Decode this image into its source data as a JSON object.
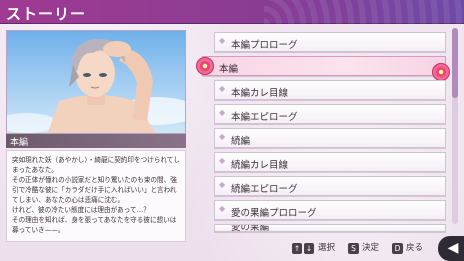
{
  "header": {
    "title": "ストーリー"
  },
  "left_panel": {
    "section_label": "本編",
    "synopsis": "突如現れた妖（あやかし）・綺龍に契約印をつけられてしまったあなた。\nその正体が憧れの小説家だと知り驚いたのも束の間、強引で冷酷な彼に「カラダだけ手に入ればいい」と言われてしまい、あなたの心は悲痛に沈む。\nけれど、彼の冷たい態度には理由があって…？\nその理由を知れば、身を張ってあなたを守る彼に想いは募っていき——。"
  },
  "chapters": [
    {
      "label": "本編プロローグ",
      "selected": false
    },
    {
      "label": "本編",
      "selected": true
    },
    {
      "label": "本編カレ目線",
      "selected": false
    },
    {
      "label": "本編エピローグ",
      "selected": false
    },
    {
      "label": "続編",
      "selected": false
    },
    {
      "label": "続編カレ目線",
      "selected": false
    },
    {
      "label": "続編エピローグ",
      "selected": false
    },
    {
      "label": "愛の果編プロローグ",
      "selected": false
    },
    {
      "label": "愛の果編",
      "selected": false
    }
  ],
  "footer": {
    "select_label": "選択",
    "confirm_key": "S",
    "confirm_label": "決定",
    "back_key": "D",
    "back_label": "戻る"
  },
  "colors": {
    "header": "#8a3c93",
    "selected_item": "#f7d5e5",
    "accent_flower": "#e8467a"
  },
  "icons": [
    "up-down-arrows-icon",
    "s-key-icon",
    "d-key-icon",
    "back-arrow-icon",
    "plum-flower-icon"
  ]
}
